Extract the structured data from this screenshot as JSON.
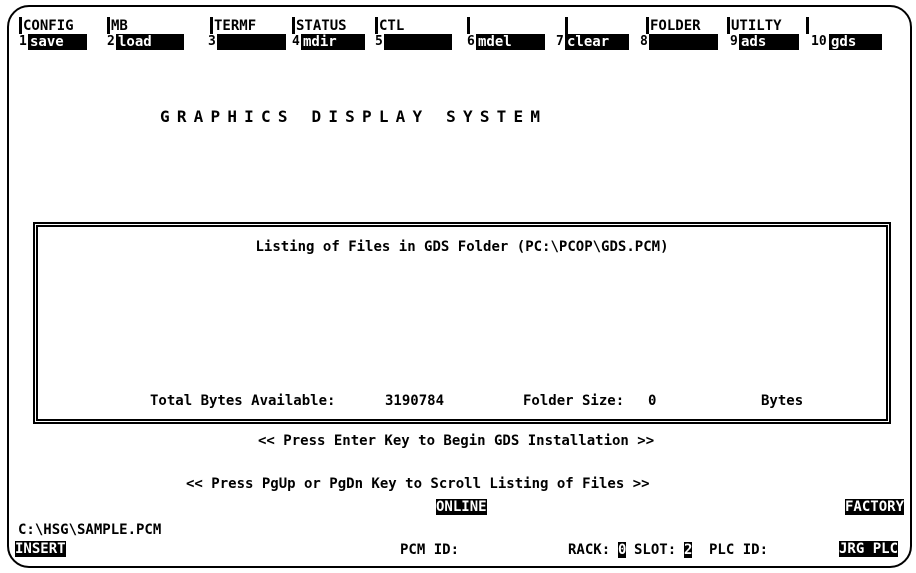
{
  "menu": {
    "headers": [
      "CONFIG",
      "MB",
      "TERMF",
      "STATUS",
      "CTL",
      "",
      "",
      "FOLDER",
      "UTILTY",
      ""
    ],
    "fkeys": [
      {
        "num": "1",
        "label": "save"
      },
      {
        "num": "2",
        "label": "load"
      },
      {
        "num": "3",
        "label": ""
      },
      {
        "num": "4",
        "label": "mdir"
      },
      {
        "num": "5",
        "label": ""
      },
      {
        "num": "6",
        "label": "mdel"
      },
      {
        "num": "7",
        "label": "clear"
      },
      {
        "num": "8",
        "label": ""
      },
      {
        "num": "9",
        "label": "ads"
      },
      {
        "num": "10",
        "label": "gds"
      }
    ]
  },
  "title": "GRAPHICS DISPLAY SYSTEM",
  "listing": {
    "heading": "Listing of Files in GDS Folder (PC:\\PCOP\\GDS.PCM)",
    "total_bytes_label": "Total Bytes Available:",
    "total_bytes_value": "3190784",
    "folder_size_label": "Folder Size:",
    "folder_size_value": "0",
    "bytes_label": "Bytes"
  },
  "prompts": {
    "enter": "<< Press Enter Key to Begin GDS Installation >>",
    "scroll": "<< Press PgUp or PgDn Key to Scroll Listing of Files >>"
  },
  "status": {
    "online": "ONLINE",
    "factory": "FACTORY",
    "path": "C:\\HSG\\SAMPLE.PCM",
    "insert": "INSERT",
    "pcm_id_label": "PCM ID:",
    "rack_label": "RACK:",
    "rack_value": "0",
    "slot_label": "SLOT:",
    "slot_value": "2",
    "plc_id_label": "PLC ID:",
    "plc_id_value": "JRG PLC"
  }
}
